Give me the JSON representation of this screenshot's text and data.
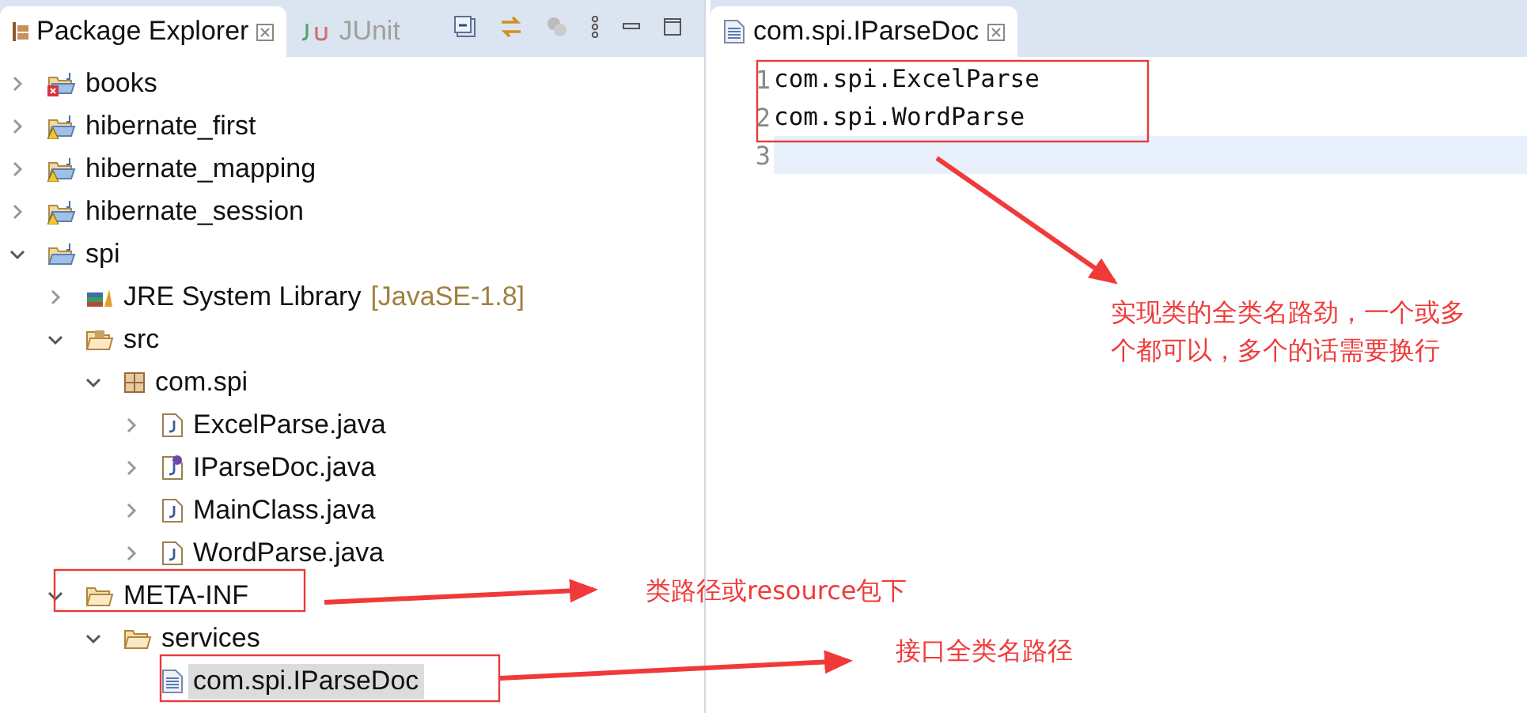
{
  "explorer": {
    "tabs": [
      {
        "label": "Package Explorer",
        "selected": true
      },
      {
        "label": "JUnit",
        "selected": false
      }
    ],
    "tree": [
      {
        "kind": "project-error",
        "label": "books",
        "expanded": false,
        "selected": false
      },
      {
        "kind": "project-warning",
        "label": "hibernate_first",
        "expanded": false,
        "selected": false
      },
      {
        "kind": "project-warning",
        "label": "hibernate_mapping",
        "expanded": false,
        "selected": false
      },
      {
        "kind": "project-warning",
        "label": "hibernate_session",
        "expanded": false,
        "selected": false
      },
      {
        "kind": "project",
        "label": "spi",
        "expanded": true,
        "selected": false,
        "children": [
          {
            "kind": "library",
            "label": "JRE System Library",
            "decoration": "[JavaSE-1.8]",
            "expanded": false,
            "selected": false
          },
          {
            "kind": "source-folder",
            "label": "src",
            "expanded": true,
            "selected": false,
            "children": [
              {
                "kind": "package",
                "label": "com.spi",
                "expanded": true,
                "selected": false,
                "children": [
                  {
                    "kind": "java-file",
                    "label": "ExcelParse.java",
                    "expanded": false,
                    "selected": false
                  },
                  {
                    "kind": "interface-file",
                    "label": "IParseDoc.java",
                    "expanded": false,
                    "selected": false
                  },
                  {
                    "kind": "java-file",
                    "label": "MainClass.java",
                    "expanded": false,
                    "selected": false
                  },
                  {
                    "kind": "java-file",
                    "label": "WordParse.java",
                    "expanded": false,
                    "selected": false
                  }
                ]
              }
            ]
          },
          {
            "kind": "folder",
            "label": "META-INF",
            "expanded": true,
            "selected": false,
            "children": [
              {
                "kind": "folder",
                "label": "services",
                "expanded": true,
                "selected": false,
                "children": [
                  {
                    "kind": "text-file",
                    "label": "com.spi.IParseDoc",
                    "selected": true
                  }
                ]
              }
            ]
          }
        ]
      }
    ]
  },
  "editor": {
    "tab": {
      "label": "com.spi.IParseDoc"
    },
    "lines": [
      {
        "number": "1",
        "text": "com.spi.ExcelParse",
        "current": false
      },
      {
        "number": "2",
        "text": "com.spi.WordParse",
        "current": false
      },
      {
        "number": "3",
        "current": true
      }
    ]
  },
  "annotations": [
    {
      "text": "实现类的全类名路劲，一个或多个都可以，多个的话需要换行"
    },
    {
      "text": "类路径或resource包下"
    },
    {
      "text": "接口全类名路径"
    }
  ]
}
